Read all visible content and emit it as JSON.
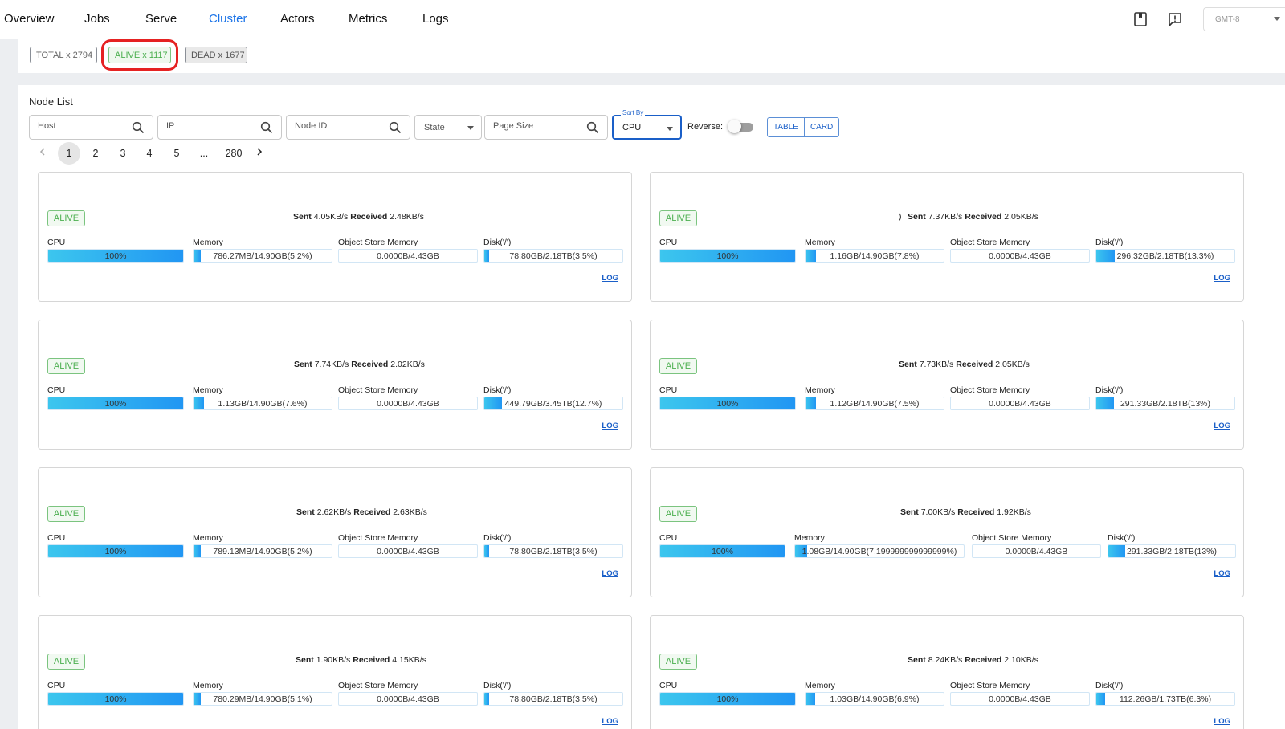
{
  "nav": {
    "tabs": [
      {
        "label": "Overview"
      },
      {
        "label": "Jobs"
      },
      {
        "label": "Serve"
      },
      {
        "label": "Cluster"
      },
      {
        "label": "Actors"
      },
      {
        "label": "Metrics"
      },
      {
        "label": "Logs"
      }
    ],
    "active_tab": "Cluster",
    "timezone": "GMT-8",
    "icons": [
      "docs-book-icon",
      "feedback-alert-icon"
    ]
  },
  "status": {
    "total": "TOTAL x 2794",
    "alive": "ALIVE x 1117",
    "dead": "DEAD x 1677"
  },
  "node_list": {
    "title": "Node List",
    "filters": {
      "host_placeholder": "Host",
      "ip_placeholder": "IP",
      "node_id_placeholder": "Node ID",
      "state_label": "State",
      "page_size_placeholder": "Page Size",
      "sort_by_legend": "Sort By",
      "sort_by_value": "CPU",
      "reverse_label": "Reverse:",
      "reverse_on": false,
      "view_table": "TABLE",
      "view_card": "CARD"
    },
    "pagination": {
      "pages": [
        "1",
        "2",
        "3",
        "4",
        "5",
        "...",
        "280"
      ],
      "current": "1"
    },
    "labels": {
      "cpu": "CPU",
      "memory": "Memory",
      "object_store": "Object Store Memory",
      "disk": "Disk('/')",
      "log": "LOG",
      "sent": "Sent",
      "received": "Received"
    },
    "cards": [
      {
        "state": "ALIVE",
        "sent": "4.05KB/s",
        "received": "2.48KB/s",
        "cpu": "100%",
        "cpu_fill": 1.0,
        "memory": "786.27MB/14.90GB(5.2%)",
        "memory_fill": 0.052,
        "object_store": "0.0000B/4.43GB",
        "object_fill": 0.0,
        "disk": "78.80GB/2.18TB(3.5%)",
        "disk_fill": 0.035
      },
      {
        "state": "ALIVE",
        "sent": "7.37KB/s",
        "received": "2.05KB/s",
        "cpu": "100%",
        "cpu_fill": 1.0,
        "memory": "1.16GB/14.90GB(7.8%)",
        "memory_fill": 0.078,
        "object_store": "0.0000B/4.43GB",
        "object_fill": 0.0,
        "disk": "296.32GB/2.18TB(13.3%)",
        "disk_fill": 0.133,
        "paren": ")"
      },
      {
        "state": "ALIVE",
        "sent": "7.74KB/s",
        "received": "2.02KB/s",
        "cpu": "100%",
        "cpu_fill": 1.0,
        "memory": "1.13GB/14.90GB(7.6%)",
        "memory_fill": 0.076,
        "object_store": "0.0000B/4.43GB",
        "object_fill": 0.0,
        "disk": "449.79GB/3.45TB(12.7%)",
        "disk_fill": 0.127
      },
      {
        "state": "ALIVE",
        "sent": "7.73KB/s",
        "received": "2.05KB/s",
        "cpu": "100%",
        "cpu_fill": 1.0,
        "memory": "1.12GB/14.90GB(7.5%)",
        "memory_fill": 0.075,
        "object_store": "0.0000B/4.43GB",
        "object_fill": 0.0,
        "disk": "291.33GB/2.18TB(13%)",
        "disk_fill": 0.13
      },
      {
        "state": "ALIVE",
        "sent": "2.62KB/s",
        "received": "2.63KB/s",
        "cpu": "100%",
        "cpu_fill": 1.0,
        "memory": "789.13MB/14.90GB(5.2%)",
        "memory_fill": 0.052,
        "object_store": "0.0000B/4.43GB",
        "object_fill": 0.0,
        "disk": "78.80GB/2.18TB(3.5%)",
        "disk_fill": 0.035
      },
      {
        "state": "ALIVE",
        "sent": "7.00KB/s",
        "received": "1.92KB/s",
        "cpu": "100%",
        "cpu_fill": 1.0,
        "memory": "1.08GB/14.90GB(7.199999999999999%)",
        "memory_fill": 0.072,
        "object_store": "0.0000B/4.43GB",
        "object_fill": 0.0,
        "disk": "291.33GB/2.18TB(13%)",
        "disk_fill": 0.13
      },
      {
        "state": "ALIVE",
        "sent": "1.90KB/s",
        "received": "4.15KB/s",
        "cpu": "100%",
        "cpu_fill": 1.0,
        "memory": "780.29MB/14.90GB(5.1%)",
        "memory_fill": 0.051,
        "object_store": "0.0000B/4.43GB",
        "object_fill": 0.0,
        "disk": "78.80GB/2.18TB(3.5%)",
        "disk_fill": 0.035
      },
      {
        "state": "ALIVE",
        "sent": "8.24KB/s",
        "received": "2.10KB/s",
        "cpu": "100%",
        "cpu_fill": 1.0,
        "memory": "1.03GB/14.90GB(6.9%)",
        "memory_fill": 0.069,
        "object_store": "0.0000B/4.43GB",
        "object_fill": 0.0,
        "disk": "112.26GB/1.73TB(6.3%)",
        "disk_fill": 0.063
      }
    ]
  },
  "colors": {
    "accent": "#1a73e8",
    "alive_green": "#4caf50",
    "bar_gradient_start": "#3cc6ee",
    "bar_gradient_end": "#2196f3",
    "highlight_red": "#e52222"
  }
}
